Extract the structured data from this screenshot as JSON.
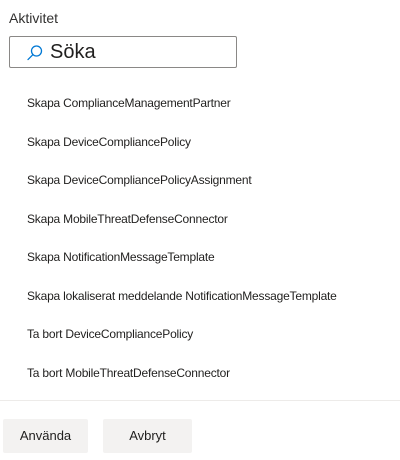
{
  "filter": {
    "label": "Aktivitet",
    "search_placeholder": "Söka",
    "search_icon": "search-icon"
  },
  "activities": [
    "Skapa ComplianceManagementPartner",
    "Skapa DeviceCompliancePolicy",
    "Skapa DeviceCompliancePolicyAssignment",
    "Skapa MobileThreatDefenseConnector",
    "Skapa NotificationMessageTemplate",
    "Skapa lokaliserat meddelande NotificationMessageTemplate",
    "Ta bort DeviceCompliancePolicy",
    "Ta bort MobileThreatDefenseConnector"
  ],
  "footer": {
    "apply_label": "Använda",
    "cancel_label": "Avbryt"
  }
}
